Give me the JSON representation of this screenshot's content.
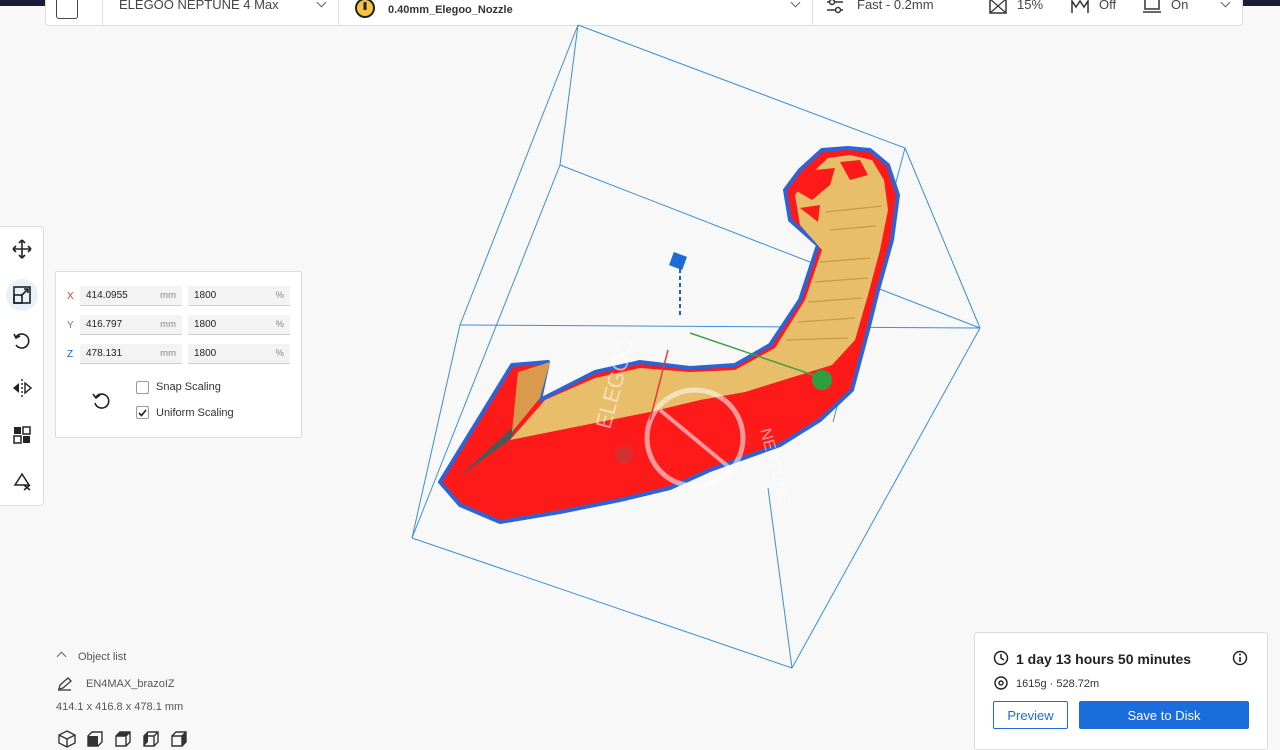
{
  "header": {
    "printer_name": "ELEGOO NEPTUNE 4 Max",
    "nozzle": "0.40mm_Elegoo_Nozzle",
    "profile": "Fast - 0.2mm",
    "infill": "15%",
    "support": "Off",
    "adhesion": "On"
  },
  "left_toolbar": {
    "tools": [
      "move-icon",
      "scale-icon",
      "rotate-icon",
      "mirror-icon",
      "per-model-settings-icon",
      "support-blocker-icon"
    ],
    "active_tool": "scale-icon"
  },
  "scale_panel": {
    "x": {
      "label": "X",
      "mm": "414.0955",
      "mm_unit": "mm",
      "percent": "1800",
      "percent_unit": "%"
    },
    "y": {
      "label": "Y",
      "mm": "416.797",
      "mm_unit": "mm",
      "percent": "1800",
      "percent_unit": "%"
    },
    "z": {
      "label": "Z",
      "mm": "478.131",
      "mm_unit": "mm",
      "percent": "1800",
      "percent_unit": "%"
    },
    "snap_scaling": {
      "label": "Snap Scaling",
      "checked": false
    },
    "uniform_scaling": {
      "label": "Uniform Scaling",
      "checked": true
    }
  },
  "colors": {
    "axis_x": "#e53935",
    "axis_y": "#43a047",
    "axis_z": "#1565c0",
    "primary": "#1a6ddb",
    "model_yellow": "#e8be6b",
    "overhang_red": "#ff1a1a",
    "build_volume": "#3a8fd6"
  },
  "object_list": {
    "header": "Object list",
    "object_name": "EN4MAX_brazoIZ",
    "dimensions": "414.1 x 416.8 x 478.1 mm",
    "view_icons": [
      "3d-view-icon",
      "front-view-icon",
      "top-view-icon",
      "left-view-icon",
      "right-view-icon"
    ]
  },
  "print_info": {
    "time": "1 day 13 hours 50 minutes",
    "material": "1615g · 528.72m",
    "preview_label": "Preview",
    "save_label": "Save to Disk"
  },
  "watermark": {
    "brand": "ELEGOO",
    "model": "NEPTUNE"
  }
}
